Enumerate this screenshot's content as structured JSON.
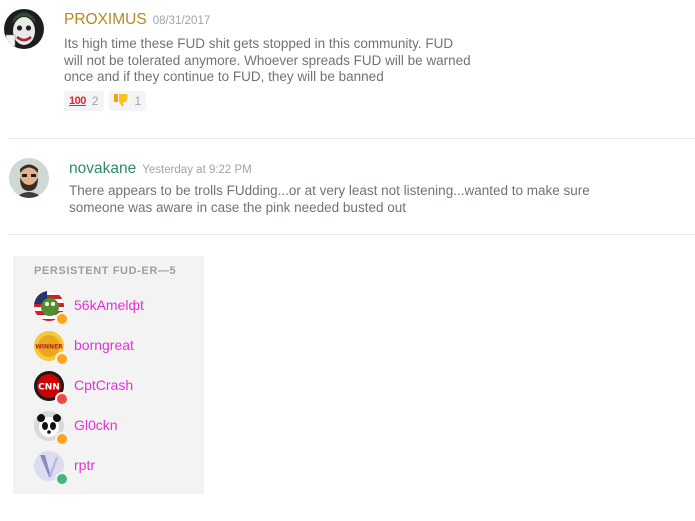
{
  "messages": [
    {
      "author": "PROXIMUS",
      "author_color": "#b7891f",
      "timestamp": "08/31/2017",
      "avatar_icon": "joker-face-icon",
      "lines": [
        "Its high time these FUD shit gets stopped in this community. FUD",
        "will not be tolerated anymore. Whoever spreads FUD will be warned",
        "once and if they continue to FUD, they will be banned"
      ],
      "reactions": [
        {
          "emoji": "💯",
          "icon": "hundred-points-icon",
          "count": "2"
        },
        {
          "emoji": "👎",
          "icon": "thumbs-down-icon",
          "count": "1"
        }
      ]
    },
    {
      "author": "novakane",
      "author_color": "#2f8a6a",
      "timestamp": "Yesterday at 9:22 PM",
      "avatar_icon": "bearded-man-avatar-icon",
      "lines": [
        "There appears to be trolls FUdding...or at very least not listening...wanted to make sure",
        "someone was aware in case the pink needed busted out"
      ]
    }
  ],
  "member_group": {
    "heading": "PERSISTENT FUD-ER—5",
    "members": [
      {
        "name": "56kAmelфt",
        "status": "idle",
        "status_color": "#faa61a",
        "avatar_icon": "flag-frog-avatar-icon"
      },
      {
        "name": "borngreat",
        "status": "idle",
        "status_color": "#faa61a",
        "avatar_icon": "winner-badge-avatar-icon"
      },
      {
        "name": "CptCrash",
        "status": "dnd",
        "status_color": "#f04747",
        "avatar_icon": "cnn-logo-avatar-icon"
      },
      {
        "name": "Gl0ckn",
        "status": "idle",
        "status_color": "#faa61a",
        "avatar_icon": "panda-avatar-icon"
      },
      {
        "name": "rptr",
        "status": "online",
        "status_color": "#43b581",
        "avatar_icon": "arrow-logo-avatar-icon"
      }
    ],
    "name_color": "#e133d6"
  }
}
